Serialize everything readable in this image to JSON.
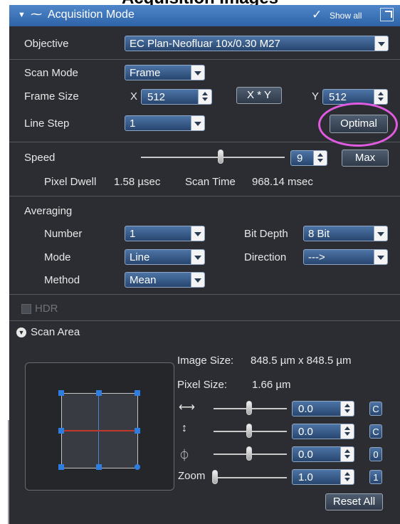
{
  "caption": "Acquisition Images",
  "header": {
    "title": "Acquisition Mode",
    "show_all": "Show all"
  },
  "objective": {
    "label": "Objective",
    "value": "EC Plan-Neofluar 10x/0.30 M27"
  },
  "scan_mode": {
    "label": "Scan Mode",
    "value": "Frame"
  },
  "frame_size": {
    "label": "Frame Size",
    "x_label": "X",
    "x_value": "512",
    "xy_button": "X * Y",
    "y_label": "Y",
    "y_value": "512"
  },
  "line_step": {
    "label": "Line Step",
    "value": "1",
    "optimal_button": "Optimal"
  },
  "speed": {
    "label": "Speed",
    "value": "9",
    "max_button": "Max",
    "pixel_dwell_label": "Pixel Dwell",
    "pixel_dwell_value": "1.58 µsec",
    "scan_time_label": "Scan Time",
    "scan_time_value": "968.14 msec"
  },
  "averaging": {
    "title": "Averaging",
    "number_label": "Number",
    "number_value": "1",
    "mode_label": "Mode",
    "mode_value": "Line",
    "method_label": "Method",
    "method_value": "Mean",
    "bit_depth_label": "Bit Depth",
    "bit_depth_value": "8 Bit",
    "direction_label": "Direction",
    "direction_value": "--->"
  },
  "hdr": {
    "label": "HDR"
  },
  "scan_area": {
    "title": "Scan Area",
    "image_size_label": "Image Size:",
    "image_size_value": "848.5 µm x 848.5 µm",
    "pixel_size_label": "Pixel Size:",
    "pixel_size_value": "1.66 µm",
    "offset_x_value": "0.0",
    "offset_x_reset": "C",
    "offset_y_value": "0.0",
    "offset_y_reset": "C",
    "rotation_value": "0.0",
    "rotation_reset": "0",
    "zoom_label": "Zoom",
    "zoom_value": "1.0",
    "zoom_reset": "1",
    "reset_all": "Reset All"
  },
  "colors": {
    "header": "#3a73b8",
    "panel": "#2b2d32",
    "highlight": "#e15be0",
    "scan_line": "#c0392b"
  }
}
